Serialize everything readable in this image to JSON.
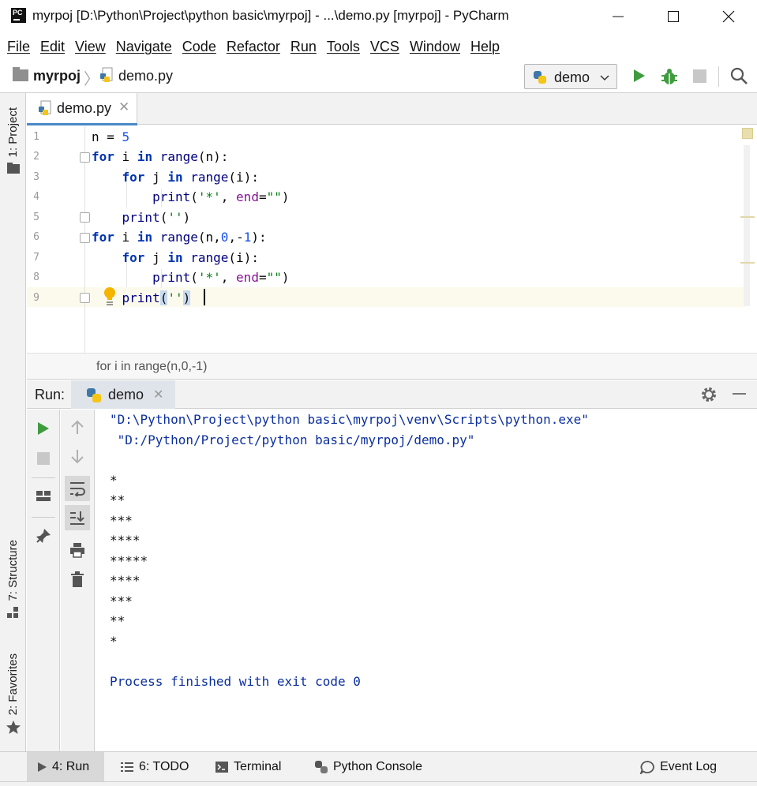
{
  "window": {
    "logo_text": "PC",
    "title": "myrpoj [D:\\Python\\Project\\python basic\\myrpoj] - ...\\demo.py [myrpoj] - PyCharm"
  },
  "menu": [
    "File",
    "Edit",
    "View",
    "Navigate",
    "Code",
    "Refactor",
    "Run",
    "Tools",
    "VCS",
    "Window",
    "Help"
  ],
  "navbar": {
    "project": "myrpoj",
    "file": "demo.py",
    "run_config": "demo"
  },
  "sidebar": {
    "project_tab": "1: Project",
    "structure_tab": "7: Structure",
    "favorites_tab": "2: Favorites"
  },
  "editor": {
    "tab_label": "demo.py",
    "line_numbers": [
      "1",
      "2",
      "3",
      "4",
      "5",
      "6",
      "7",
      "8",
      "9"
    ],
    "breadcrumb": "for i in range(n,0,-1)",
    "current_line": 9
  },
  "run_panel": {
    "title": "Run:",
    "tab_label": "demo",
    "command_line_1": "\"D:\\Python\\Project\\python basic\\myrpoj\\venv\\Scripts\\python.exe\"",
    "command_line_2": " \"D:/Python/Project/python basic/myrpoj/demo.py\"",
    "output": [
      "*",
      "**",
      "***",
      "****",
      "*****",
      "****",
      "***",
      "**",
      "*"
    ],
    "exit_message": "Process finished with exit code 0"
  },
  "bottom_tabs": {
    "run": "4: Run",
    "todo": "6: TODO",
    "terminal": "Terminal",
    "python_console": "Python Console",
    "event_log": "Event Log"
  },
  "colors": {
    "keyword": "#0033b3",
    "string": "#067d17",
    "number": "#1750eb",
    "console_command": "#0b2f9e",
    "run_green": "#3e9c3e",
    "tab_underline": "#4a88c7"
  }
}
